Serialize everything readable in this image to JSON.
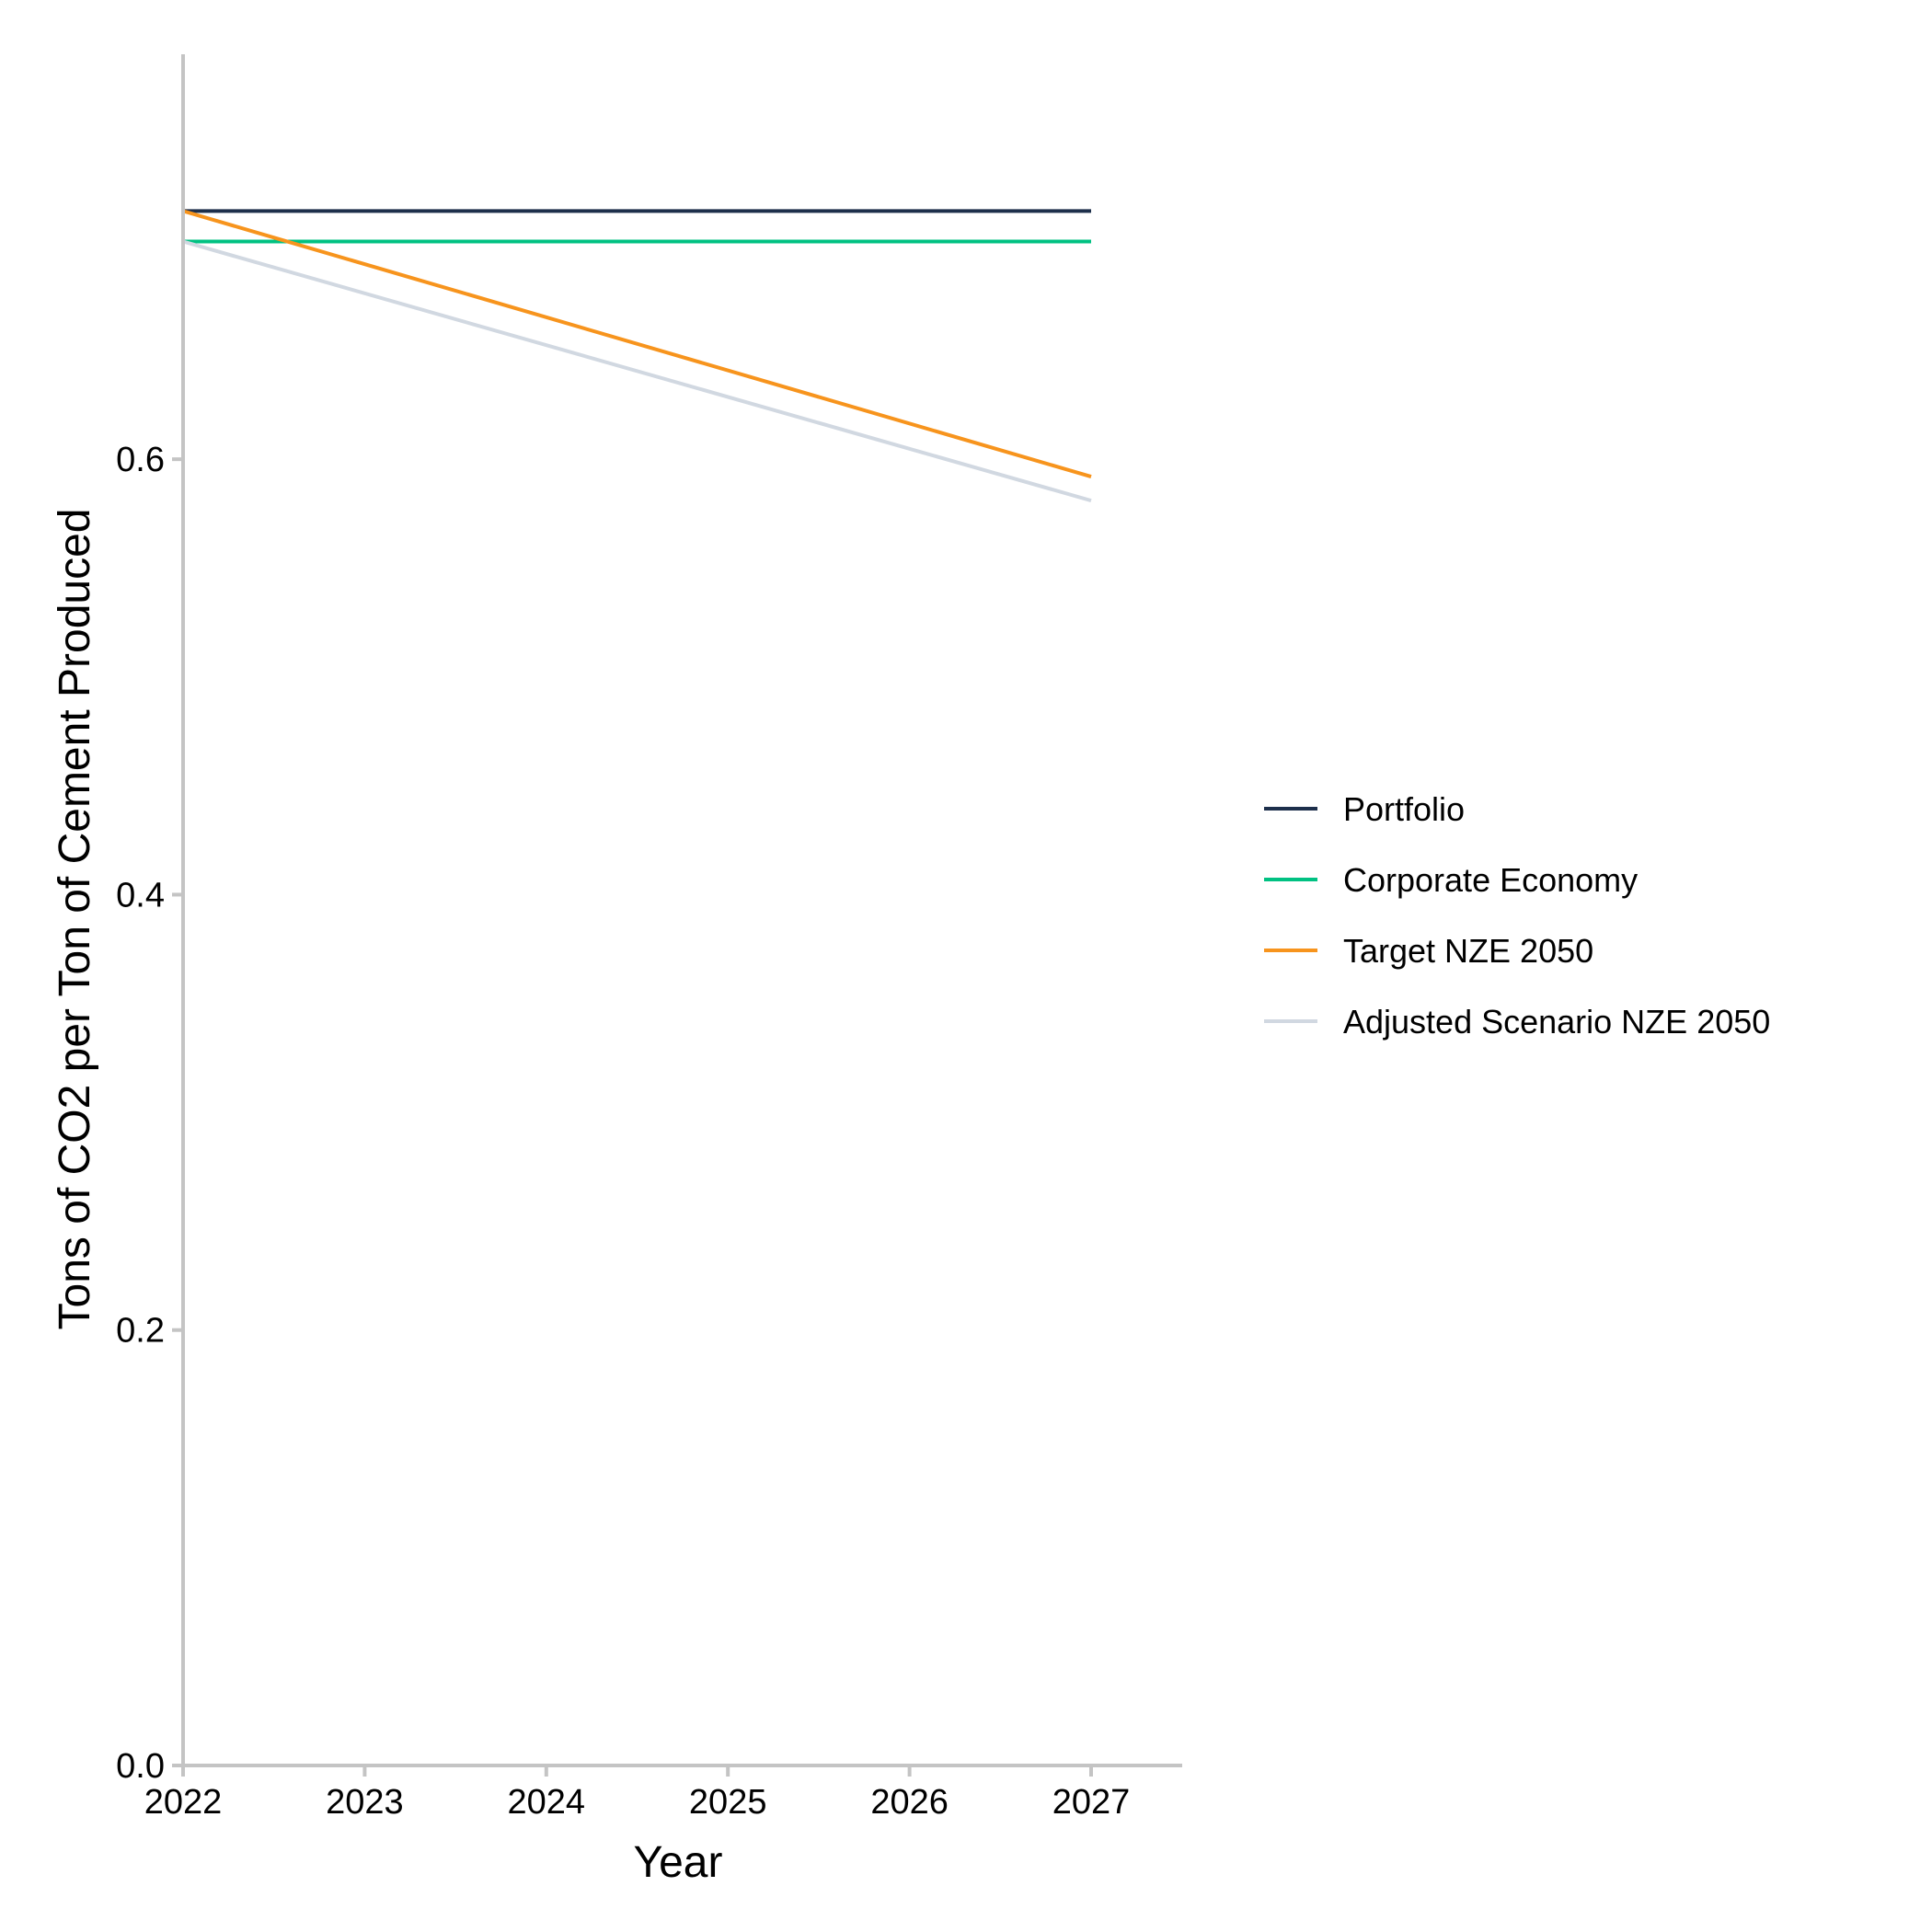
{
  "chart_data": {
    "type": "line",
    "title": "",
    "xlabel": "Year",
    "ylabel": "Tons of CO2 per Ton of Cement Produced",
    "x": [
      2022,
      2023,
      2024,
      2025,
      2026,
      2027
    ],
    "xlim": [
      2022,
      2027.5
    ],
    "ylim": [
      0,
      0.786
    ],
    "xticks": [
      "2022",
      "2023",
      "2024",
      "2025",
      "2026",
      "2027"
    ],
    "yticks": [
      "0.0",
      "0.2",
      "0.4",
      "0.6"
    ],
    "ytick_values": [
      0.0,
      0.2,
      0.4,
      0.6
    ],
    "grid": false,
    "legend_position": "right",
    "series": [
      {
        "name": "Portfolio",
        "color": "#1d2f4b",
        "x": [
          2022,
          2027
        ],
        "values": [
          0.714,
          0.714
        ]
      },
      {
        "name": "Corporate Economy",
        "color": "#00c182",
        "x": [
          2022,
          2027
        ],
        "values": [
          0.7,
          0.7
        ]
      },
      {
        "name": "Target NZE 2050",
        "color": "#f7941d",
        "x": [
          2022,
          2027
        ],
        "values": [
          0.714,
          0.592
        ]
      },
      {
        "name": "Adjusted Scenario NZE 2050",
        "color": "#d1d8e1",
        "x": [
          2022,
          2027
        ],
        "values": [
          0.7,
          0.581
        ]
      }
    ]
  }
}
